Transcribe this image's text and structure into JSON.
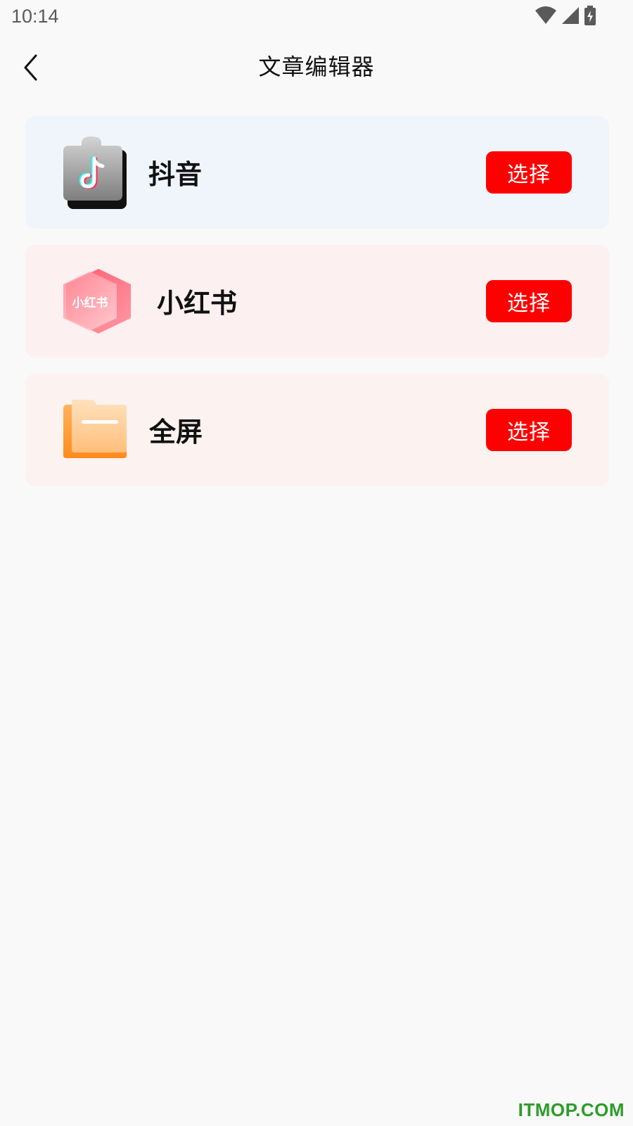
{
  "status_bar": {
    "time": "10:14",
    "icons": [
      "wifi-icon",
      "signal-icon",
      "battery-charging-icon"
    ]
  },
  "header": {
    "back_icon": "chevron-left-icon",
    "title": "文章编辑器"
  },
  "cards": [
    {
      "label": "抖音",
      "icon": "douyin-app-icon",
      "button_label": "选择",
      "background": "#f0f5fb"
    },
    {
      "label": "小红书",
      "icon": "xiaohongshu-app-icon",
      "icon_text": "小红书",
      "button_label": "选择",
      "background": "#fcf0f0"
    },
    {
      "label": "全屏",
      "icon": "folder-icon",
      "button_label": "选择",
      "background": "#fcf2ef"
    }
  ],
  "colors": {
    "accent": "#fe0000",
    "page_background": "#f9f9f9",
    "watermark": "#2e9c2a"
  },
  "watermark": "ITMOP.COM"
}
